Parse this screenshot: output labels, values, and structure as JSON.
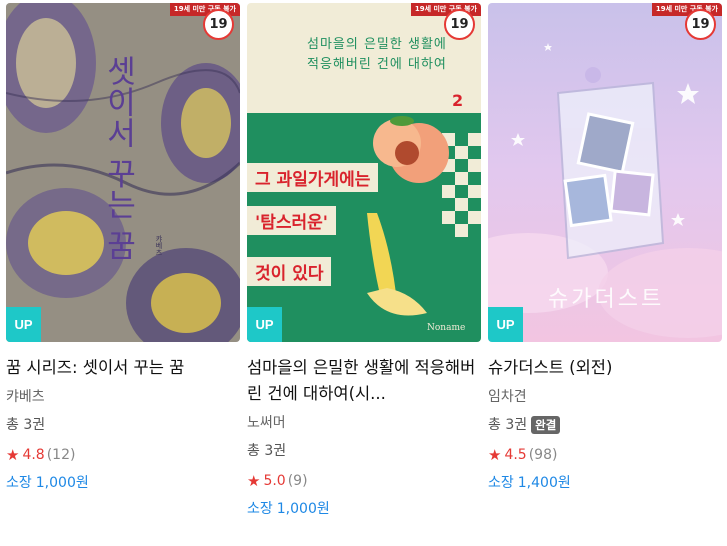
{
  "books": [
    {
      "cover": {
        "age_notice": "19세 미만 구독 불가",
        "age_rating": "19",
        "up_label": "UP",
        "title_text": "셋이서 꾸는 꿈",
        "author_text": "캬베츠",
        "colors": {
          "bg": "#8e8a80",
          "accent": "#6b4f9a",
          "gold": "#e4c94a"
        }
      },
      "title": "꿈 시리즈: 셋이서 꾸는 꿈",
      "author": "캬베츠",
      "volumes": "총 3권",
      "complete": "",
      "rating": "4.8",
      "rating_count": "(12)",
      "price_label": "소장",
      "price": "1,000원"
    },
    {
      "cover": {
        "age_notice": "19세 미만 구독 불가",
        "age_rating": "19",
        "up_label": "UP",
        "headline_1": "섬마을의 은밀한 생활에",
        "headline_2": "적응해버린 건에 대하여",
        "volume_no": "2",
        "tag_1": "그 과일가게에는",
        "tag_2": "'탐스러운'",
        "tag_3": "것이 있다",
        "colors": {
          "green": "#1e8f5e",
          "red": "#d9232d",
          "cream": "#f2ecd6"
        }
      },
      "title": "섬마을의 은밀한 생활에 적응해버린 건에 대하여(시...",
      "author": "노써머",
      "volumes": "총 3권",
      "complete": "",
      "rating": "5.0",
      "rating_count": "(9)",
      "price_label": "소장",
      "price": "1,000원"
    },
    {
      "cover": {
        "age_notice": "19세 미만 구독 불가",
        "age_rating": "19",
        "up_label": "UP",
        "title_text": "슈가더스트",
        "colors": {
          "sky": "#d9c4ef",
          "pink": "#f3c6e4",
          "blue": "#b9c6f0"
        }
      },
      "title": "슈가더스트 (외전)",
      "author": "임차견",
      "volumes": "총 3권",
      "complete": "완결",
      "rating": "4.5",
      "rating_count": "(98)",
      "price_label": "소장",
      "price": "1,400원"
    }
  ]
}
